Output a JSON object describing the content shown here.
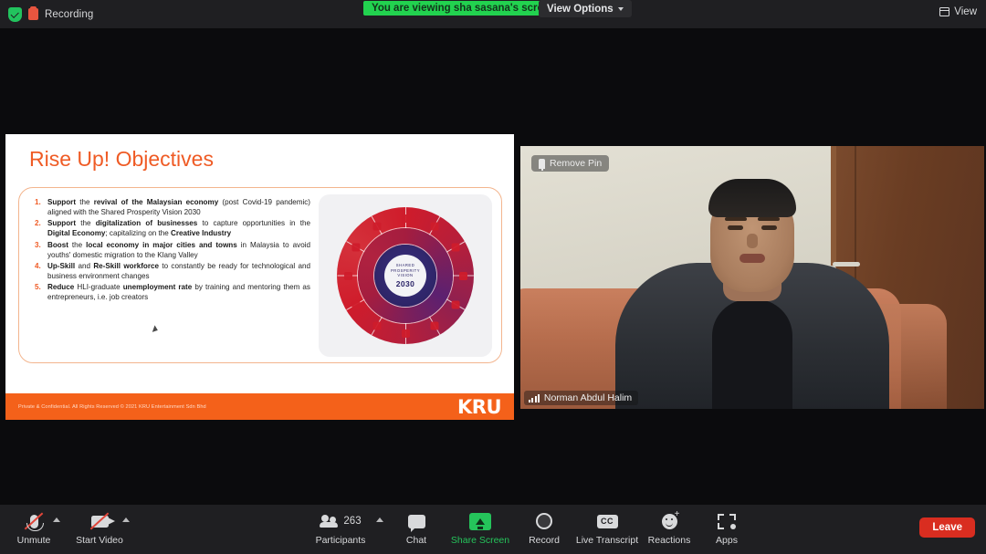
{
  "topbar": {
    "recording_label": "Recording",
    "shield_icon": "shield-check-icon",
    "recording_icon": "recording-indicator-icon",
    "viewing_banner": "You are viewing sha sasana's screen",
    "view_options_label": "View Options",
    "view_button_label": "View",
    "view_button_icon": "layout-grid-icon",
    "banner_color": "#22d24f"
  },
  "slide": {
    "title": "Rise Up! Objectives",
    "title_color": "#ef5b25",
    "bullets": [
      {
        "n": "1.",
        "html": "<b>Support</b> the <b>revival of the Malaysian economy</b> (post Covid-19 pandemic) aligned with the Shared Prosperity Vision 2030"
      },
      {
        "n": "2.",
        "html": "<b>Support</b> the <b>digitalization of businesses</b> to capture opportunities in the <b>Digital Economy</b>; capitalizing on the <b>Creative Industry</b>"
      },
      {
        "n": "3.",
        "html": "<b>Boost</b> the <b>local economy in major cities and towns</b> in Malaysia to avoid youths' domestic migration to the Klang Valley"
      },
      {
        "n": "4.",
        "html": "<b>Up-Skill</b> and <b>Re-Skill workforce</b> to constantly be ready for technological and business environment changes"
      },
      {
        "n": "5.",
        "html": "<b>Reduce</b> HLI-graduate <b>unemployment rate</b> by training and mentoring them as entrepreneurs, i.e. job creators"
      }
    ],
    "wheel": {
      "center_line1": "SHARED PROSPERITY VISION",
      "center_line2": "2030",
      "name": "shared-prosperity-vision-2030-wheel"
    },
    "footer_text": "Private & Confidential. All Rights Reserved © 2021 KRU Entertainment Sdn Bhd",
    "logo": "KRU",
    "footer_color": "#f4611a"
  },
  "video": {
    "pin_label": "Remove Pin",
    "pin_icon": "pin-icon",
    "participant_name": "Norman Abdul Halim",
    "audio_icon": "audio-level-icon"
  },
  "toolbar": {
    "mute": {
      "label": "Unmute",
      "icon": "microphone-muted-icon"
    },
    "video": {
      "label": "Start Video",
      "icon": "camera-off-icon"
    },
    "participants": {
      "label": "Participants",
      "count": "263",
      "icon": "participants-icon"
    },
    "chat": {
      "label": "Chat",
      "icon": "chat-bubble-icon"
    },
    "share": {
      "label": "Share Screen",
      "icon": "share-screen-icon",
      "color": "#25c45b"
    },
    "record": {
      "label": "Record",
      "icon": "record-circle-icon"
    },
    "transcript": {
      "label": "Live Transcript",
      "icon": "closed-caption-icon",
      "cc_text": "CC"
    },
    "reactions": {
      "label": "Reactions",
      "icon": "reactions-smiley-icon"
    },
    "apps": {
      "label": "Apps",
      "icon": "apps-icon"
    },
    "leave": {
      "label": "Leave",
      "color": "#d92d20"
    }
  }
}
